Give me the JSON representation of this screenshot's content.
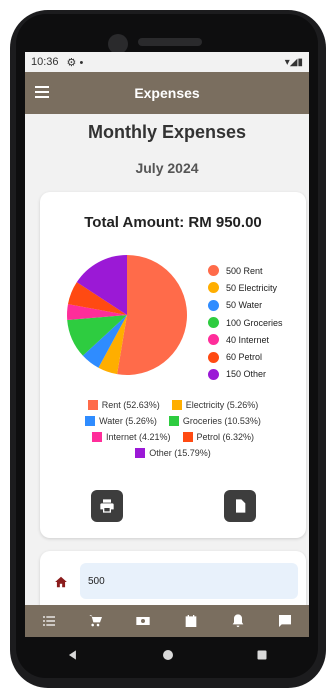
{
  "status_bar": {
    "time": "10:36",
    "icons": "▾◢▮"
  },
  "app_bar": {
    "title": "Expenses"
  },
  "header": {
    "title": "Monthly Expenses",
    "month": "July 2024"
  },
  "summary": {
    "total_label": "Total Amount: RM 950.00"
  },
  "chart_data": {
    "type": "pie",
    "title": "",
    "slices": [
      {
        "label": "Rent",
        "value": 500,
        "percent": 52.63,
        "color": "#ff6b4a"
      },
      {
        "label": "Electricity",
        "value": 50,
        "percent": 5.26,
        "color": "#ffae00"
      },
      {
        "label": "Water",
        "value": 50,
        "percent": 5.26,
        "color": "#2f8cff"
      },
      {
        "label": "Groceries",
        "value": 100,
        "percent": 10.53,
        "color": "#2ecc40"
      },
      {
        "label": "Internet",
        "value": 40,
        "percent": 4.21,
        "color": "#ff2d9a"
      },
      {
        "label": "Petrol",
        "value": 60,
        "percent": 6.32,
        "color": "#ff4a12"
      },
      {
        "label": "Other",
        "value": 150,
        "percent": 15.79,
        "color": "#9b19d6"
      }
    ]
  },
  "legend_right": [
    "500 Rent",
    "50 Electricity",
    "50 Water",
    "100 Groceries",
    "40 Internet",
    "60 Petrol",
    "150 Other"
  ],
  "legend_bottom": [
    "Rent (52.63%)",
    "Electricity (5.26%)",
    "Water (5.26%)",
    "Groceries (10.53%)",
    "Internet (4.21%)",
    "Petrol (6.32%)",
    "Other (15.79%)"
  ],
  "actions": {
    "print": "print-icon",
    "export": "document-icon"
  },
  "entry": {
    "value": "500"
  },
  "bottom_nav": [
    "list-icon",
    "cart-icon",
    "money-icon",
    "calendar-icon",
    "bell-icon",
    "message-icon"
  ],
  "colors": {
    "app_bar": "#7a6e5f",
    "home_icon": "#8b1c1c",
    "input_bg": "#e8f1fb"
  }
}
